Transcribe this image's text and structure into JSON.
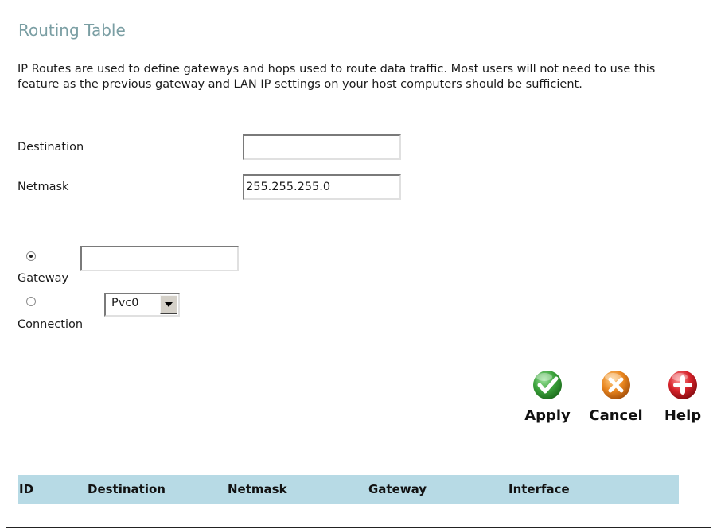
{
  "page": {
    "title": "Routing Table",
    "description": "IP Routes are used to define gateways and hops used to route data traffic. Most users will not need to use this feature as the previous gateway and LAN IP settings on your host computers should be sufficient."
  },
  "form": {
    "destination": {
      "label": "Destination",
      "value": ""
    },
    "netmask": {
      "label": "Netmask",
      "value": "255.255.255.0"
    },
    "gateway": {
      "label": "Gateway",
      "value": "",
      "selected": true
    },
    "connection": {
      "label": "Connection",
      "selected_option": "Pvc0",
      "selected": false
    }
  },
  "actions": {
    "apply": {
      "label": "Apply",
      "color": "#3aa13a"
    },
    "cancel": {
      "label": "Cancel",
      "color": "#e9861f"
    },
    "help": {
      "label": "Help",
      "color": "#d6222a"
    }
  },
  "table": {
    "header_color": "#b7dae5",
    "columns": [
      "ID",
      "Destination",
      "Netmask",
      "Gateway",
      "Interface"
    ]
  }
}
